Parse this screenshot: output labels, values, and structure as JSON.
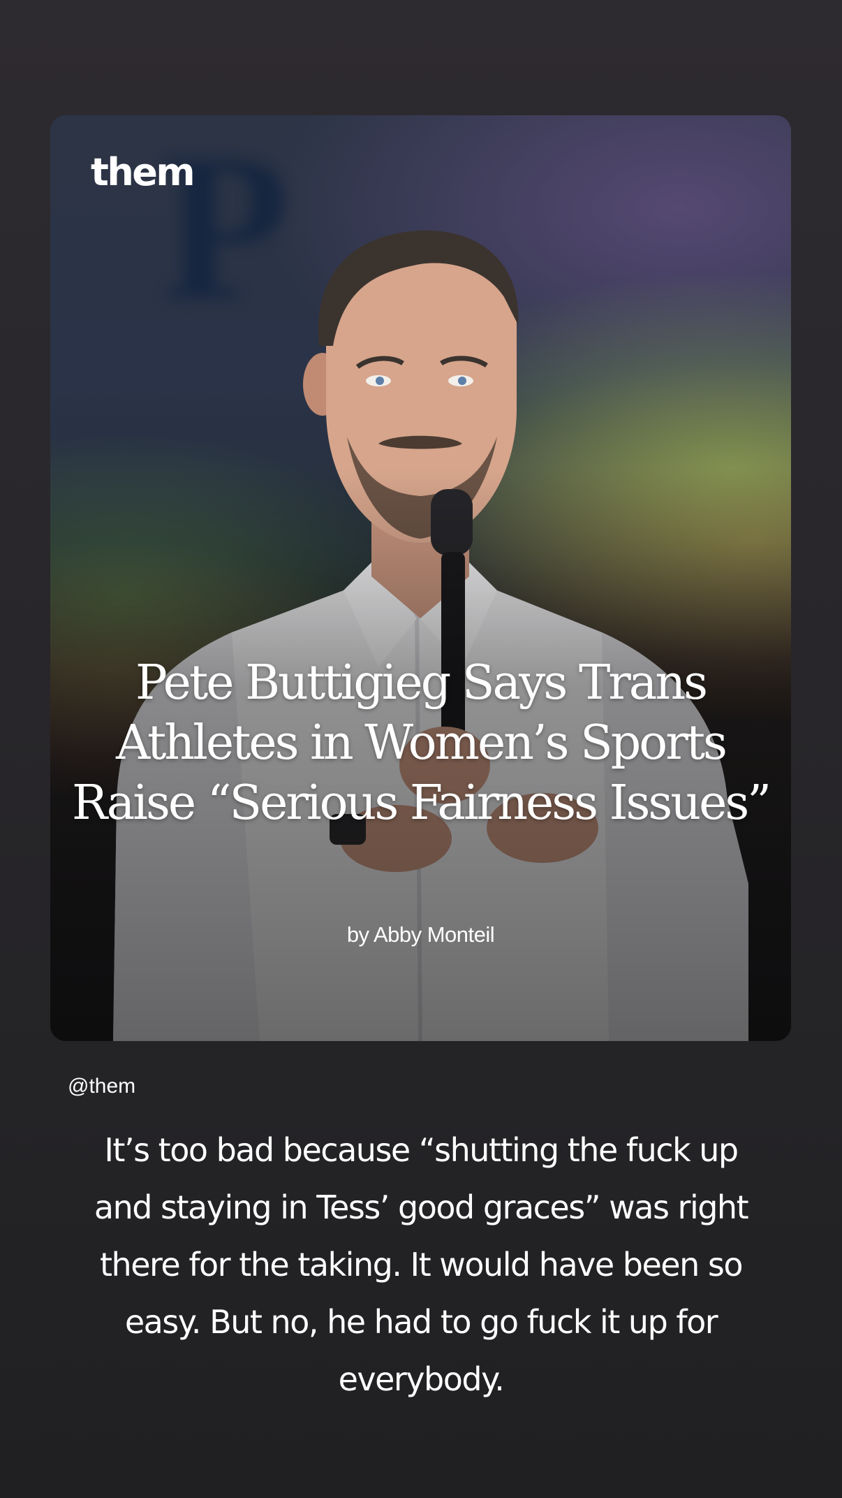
{
  "post": {
    "brand": "them",
    "headline": "Pete Buttigieg Says Trans Athletes in Women’s Sports Raise “Serious Fairness Issues”",
    "byline": "by Abby Monteil"
  },
  "mention": "@them",
  "caption": "It’s too bad because “shutting the fuck up and staying in Tess’ good graces” was right there for the taking. It would have been so easy. But no, he had to go fuck it up for everybody."
}
